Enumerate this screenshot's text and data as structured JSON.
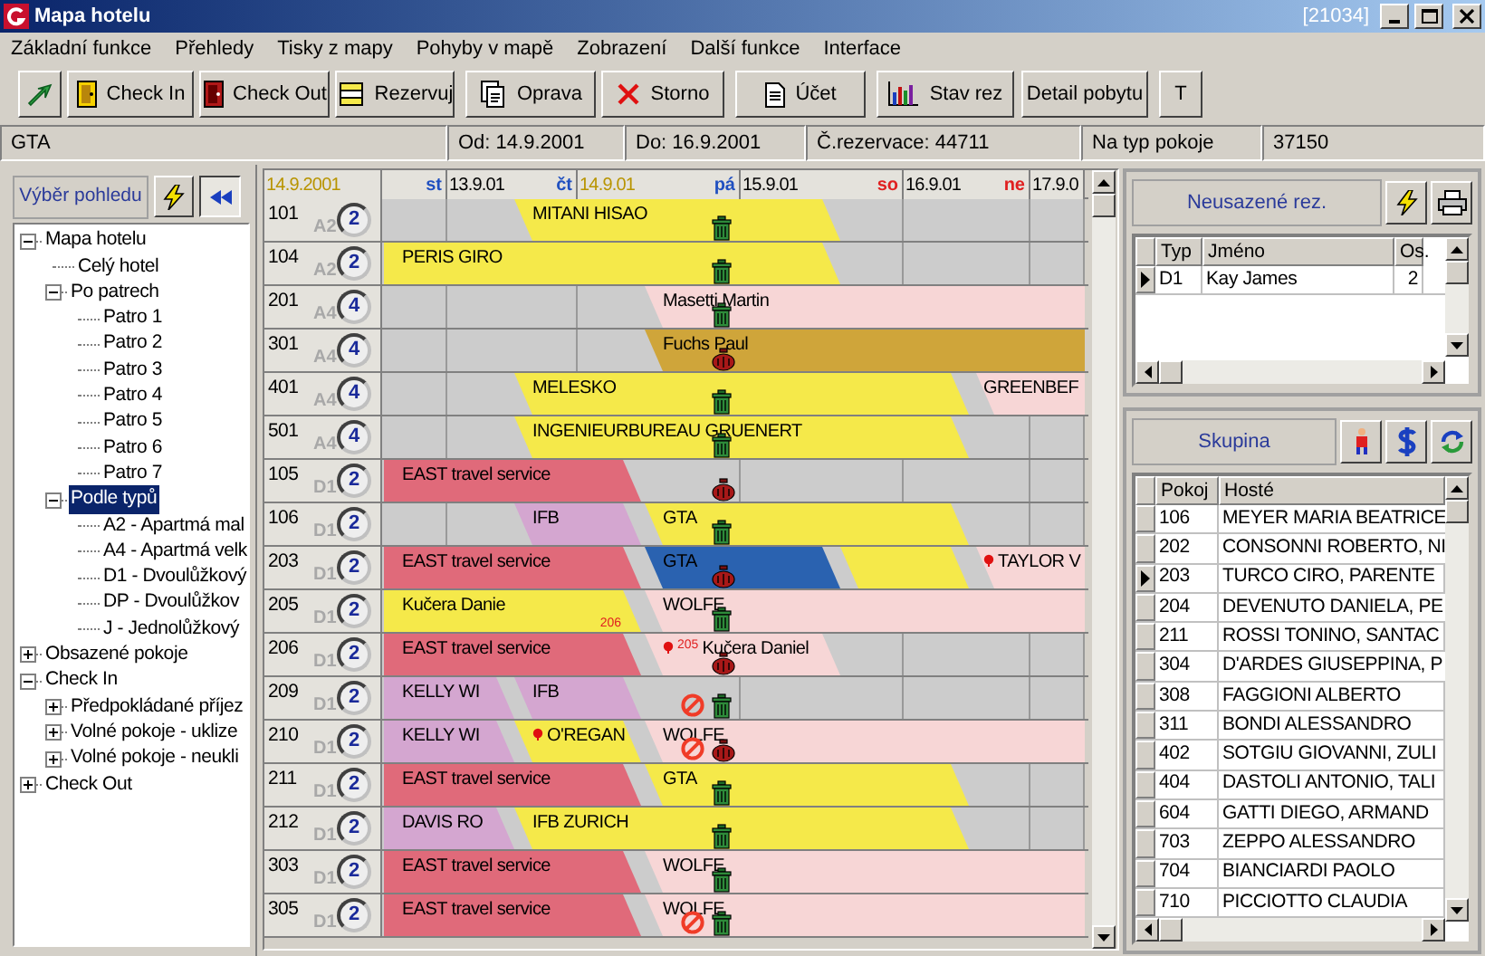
{
  "window": {
    "title": "Mapa hotelu",
    "id": "[21034]"
  },
  "menu": [
    "Základní funkce",
    "Přehledy",
    "Tisky z mapy",
    "Pohyby v mapě",
    "Zobrazení",
    "Další funkce",
    "Interface"
  ],
  "toolbar": [
    {
      "kind": "back"
    },
    {
      "kind": "checkin",
      "label": "Check In"
    },
    {
      "kind": "checkout",
      "label": "Check Out"
    },
    {
      "kind": "reserve",
      "label": "Rezervuj"
    },
    {
      "kind": "edit",
      "label": "Oprava"
    },
    {
      "kind": "cancel",
      "label": "Storno"
    },
    {
      "kind": "bill",
      "label": "Účet"
    },
    {
      "kind": "status",
      "label": "Stav rez"
    },
    {
      "kind": "plain",
      "label": "Detail pobytu"
    },
    {
      "kind": "plain",
      "label": "T"
    }
  ],
  "info": [
    "GTA",
    "Od: 14.9.2001",
    "Do: 16.9.2001",
    "Č.rezervace: 44711",
    "Na typ pokoje",
    "37150"
  ],
  "view_panel": {
    "button": "Výběr pohledu",
    "tree": [
      {
        "label": "Mapa hotelu",
        "expanded": true,
        "selected": false,
        "children": [
          {
            "label": "Celý hotel",
            "selected": false
          },
          {
            "label": "Po patrech",
            "expanded": true,
            "selected": false,
            "children": [
              {
                "label": "Patro 1",
                "selected": false
              },
              {
                "label": "Patro 2",
                "selected": false
              },
              {
                "label": "Patro 3",
                "selected": false
              },
              {
                "label": "Patro 4",
                "selected": false
              },
              {
                "label": "Patro 5",
                "selected": false
              },
              {
                "label": "Patro 6",
                "selected": false
              },
              {
                "label": "Patro 7",
                "selected": false
              }
            ]
          },
          {
            "label": "Podle typů",
            "expanded": true,
            "selected": true,
            "children": [
              {
                "label": "A2 - Apartmá mal",
                "selected": false
              },
              {
                "label": "A4 - Apartmá velk",
                "selected": false
              },
              {
                "label": "D1 - Dvoulůžkový",
                "selected": false
              },
              {
                "label": "DP - Dvoulůžkov",
                "selected": false
              },
              {
                "label": "J - Jednolůžkový",
                "selected": false
              }
            ]
          }
        ]
      },
      {
        "label": "Obsazené pokoje",
        "expanded": false,
        "selected": false
      },
      {
        "label": "Check In",
        "expanded": true,
        "selected": false,
        "children": [
          {
            "label": "Předpokládané příjez",
            "expanded": false,
            "selected": false
          },
          {
            "label": "Volné pokoje - uklize",
            "expanded": false,
            "selected": false
          },
          {
            "label": "Volné pokoje - neukli",
            "expanded": false,
            "selected": false
          }
        ]
      },
      {
        "label": "Check Out",
        "expanded": false,
        "selected": false
      }
    ]
  },
  "timeline": {
    "header": [
      {
        "date": "14.9.2001",
        "current": true
      },
      {
        "day": "st",
        "weekend": false
      },
      {
        "date": "13.9.01",
        "current": false,
        "day": "čt",
        "weekend": false
      },
      {
        "date": "14.9.01",
        "current": true,
        "day": "pá",
        "weekend": false
      },
      {
        "date": "15.9.01",
        "current": false,
        "day": "so",
        "weekend": true
      },
      {
        "date": "16.9.01",
        "current": false,
        "day": "ne",
        "weekend": true
      },
      {
        "date": "17.9.0",
        "current": false
      }
    ],
    "rows": [
      {
        "room": "101",
        "type": "A2",
        "beds": "2",
        "dirty": false,
        "blocked": false,
        "bookings": [
          {
            "name": "MITANI HISAO",
            "color": "#f5e94a"
          }
        ]
      },
      {
        "room": "104",
        "type": "A2",
        "beds": "2",
        "dirty": false,
        "blocked": false,
        "bookings": [
          {
            "name": "PERIS GIRO",
            "color": "#f5e94a"
          }
        ]
      },
      {
        "room": "201",
        "type": "A4",
        "beds": "4",
        "dirty": false,
        "blocked": false,
        "bookings": [
          {
            "name": "Masetti Martin",
            "color": "#f7d6d6"
          }
        ]
      },
      {
        "room": "301",
        "type": "A4",
        "beds": "4",
        "dirty": true,
        "blocked": false,
        "bookings": [
          {
            "name": "Fuchs Paul",
            "color": "#cfa53a"
          }
        ]
      },
      {
        "room": "401",
        "type": "A4",
        "beds": "4",
        "dirty": false,
        "blocked": false,
        "bookings": [
          {
            "name": "MELESKO",
            "color": "#f5e94a"
          },
          {
            "name": "GREENBEF",
            "color": "#f7d6d6"
          }
        ]
      },
      {
        "room": "501",
        "type": "A4",
        "beds": "4",
        "dirty": false,
        "blocked": false,
        "bookings": [
          {
            "name": "INGENIEURBUREAU GRUENERT",
            "color": "#f5e94a"
          }
        ]
      },
      {
        "room": "105",
        "type": "D1",
        "beds": "2",
        "dirty": true,
        "blocked": false,
        "bookings": [
          {
            "name": "EAST travel service",
            "color": "#e06a7a"
          }
        ]
      },
      {
        "room": "106",
        "type": "D1",
        "beds": "2",
        "dirty": false,
        "blocked": false,
        "bookings": [
          {
            "name": "IFB",
            "color": "#d4a6d0"
          },
          {
            "name": "GTA",
            "color": "#f5e94a"
          }
        ]
      },
      {
        "room": "203",
        "type": "D1",
        "beds": "2",
        "dirty": true,
        "blocked": false,
        "bookings": [
          {
            "name": "EAST travel service",
            "color": "#e06a7a"
          },
          {
            "name": "GTA",
            "color": "#2a62b0"
          },
          {
            "color": "#f5e94a"
          },
          {
            "name": "TAYLOR V",
            "color": "#f7d6d6",
            "marker": true
          }
        ]
      },
      {
        "room": "205",
        "type": "D1",
        "beds": "2",
        "dirty": false,
        "blocked": false,
        "bookings": [
          {
            "name": "Kučera Danie",
            "color": "#f5e94a",
            "ref": "206"
          },
          {
            "name": "WOLFE",
            "color": "#f7d6d6"
          }
        ]
      },
      {
        "room": "206",
        "type": "D1",
        "beds": "2",
        "dirty": true,
        "blocked": false,
        "bookings": [
          {
            "name": "EAST travel service",
            "color": "#e06a7a"
          },
          {
            "name": "Kučera Daniel",
            "color": "#f7d6d6",
            "marker": true,
            "ref": "205"
          }
        ]
      },
      {
        "room": "209",
        "type": "D1",
        "beds": "2",
        "dirty": false,
        "blocked": true,
        "bookings": [
          {
            "name": "KELLY WI",
            "color": "#d4a6d0"
          },
          {
            "name": "IFB",
            "color": "#d4a6d0"
          }
        ]
      },
      {
        "room": "210",
        "type": "D1",
        "beds": "2",
        "dirty": true,
        "blocked": true,
        "bookings": [
          {
            "name": "KELLY WI",
            "color": "#d4a6d0"
          },
          {
            "name": "O'REGAN",
            "color": "#f5e94a",
            "marker": true
          },
          {
            "name": "WOLFE",
            "color": "#f7d6d6"
          }
        ]
      },
      {
        "room": "211",
        "type": "D1",
        "beds": "2",
        "dirty": false,
        "blocked": false,
        "bookings": [
          {
            "name": "EAST travel service",
            "color": "#e06a7a"
          },
          {
            "name": "GTA",
            "color": "#f5e94a"
          }
        ]
      },
      {
        "room": "212",
        "type": "D1",
        "beds": "2",
        "dirty": false,
        "blocked": false,
        "bookings": [
          {
            "name": "DAVIS RO",
            "color": "#d4a6d0"
          },
          {
            "name": "IFB ZURICH",
            "color": "#f5e94a"
          }
        ]
      },
      {
        "room": "303",
        "type": "D1",
        "beds": "2",
        "dirty": false,
        "blocked": false,
        "bookings": [
          {
            "name": "EAST travel service",
            "color": "#e06a7a"
          },
          {
            "name": "WOLFE",
            "color": "#f7d6d6"
          }
        ]
      },
      {
        "room": "305",
        "type": "D1",
        "beds": "2",
        "dirty": false,
        "blocked": true,
        "bookings": [
          {
            "name": "EAST travel service",
            "color": "#e06a7a"
          },
          {
            "name": "WOLFE",
            "color": "#f7d6d6"
          }
        ]
      }
    ]
  },
  "unseated": {
    "title": "Neusazené rez.",
    "columns": [
      "Typ",
      "Jméno",
      "Os."
    ],
    "rows": [
      {
        "cells": [
          "D1",
          "Kay James",
          "2"
        ],
        "current": true
      }
    ]
  },
  "group": {
    "title": "Skupina",
    "columns": [
      "Pokoj",
      "Hosté"
    ],
    "rows": [
      {
        "cells": [
          "106",
          "MEYER MARIA BEATRICE"
        ],
        "current": false
      },
      {
        "cells": [
          "202",
          "CONSONNI ROBERTO, NI"
        ],
        "current": false
      },
      {
        "cells": [
          "203",
          "TURCO CIRO, PARENTE"
        ],
        "current": true
      },
      {
        "cells": [
          "204",
          "DEVENUTO DANIELA, PE"
        ],
        "current": false
      },
      {
        "cells": [
          "211",
          "ROSSI TONINO, SANTAC"
        ],
        "current": false
      },
      {
        "cells": [
          "304",
          "D'ARDES GIUSEPPINA, P"
        ],
        "current": false
      },
      {
        "cells": [
          "308",
          "FAGGIONI ALBERTO"
        ],
        "current": false
      },
      {
        "cells": [
          "311",
          "BONDI ALESSANDRO"
        ],
        "current": false
      },
      {
        "cells": [
          "402",
          "SOTGIU GIOVANNI, ZULI"
        ],
        "current": false
      },
      {
        "cells": [
          "404",
          "DASTOLI ANTONIO, TALI"
        ],
        "current": false
      },
      {
        "cells": [
          "604",
          "GATTI DIEGO, ARMAND"
        ],
        "current": false
      },
      {
        "cells": [
          "703",
          "ZEPPO ALESSANDRO"
        ],
        "current": false
      },
      {
        "cells": [
          "704",
          "BIANCIARDI PAOLO"
        ],
        "current": false
      },
      {
        "cells": [
          "710",
          "PICCIOTTO CLAUDIA"
        ],
        "current": false
      }
    ]
  }
}
